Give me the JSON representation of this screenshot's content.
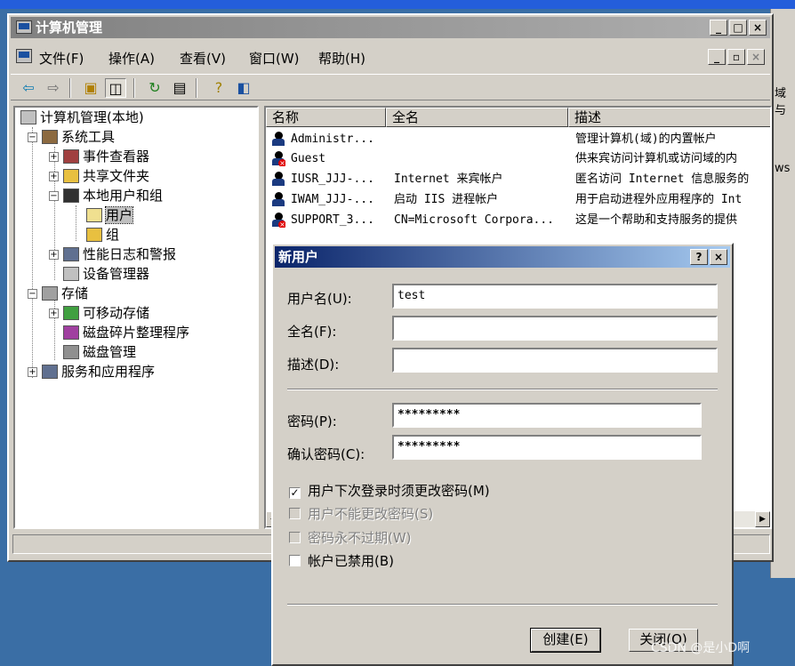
{
  "window": {
    "title": "计算机管理",
    "caption_buttons": [
      "_",
      "□",
      "×"
    ],
    "mdi_buttons": [
      "_",
      "▫",
      "×"
    ]
  },
  "menu": [
    "文件(F)",
    "操作(A)",
    "查看(V)",
    "窗口(W)",
    "帮助(H)"
  ],
  "toolbar": [
    "back-icon",
    "forward-icon",
    "up-folder-icon",
    "show-tree-icon",
    "refresh-icon",
    "export-icon",
    "help-icon",
    "view-icon"
  ],
  "tree": {
    "root": "计算机管理(本地)",
    "system_tools": "系统工具",
    "event_viewer": "事件查看器",
    "shared_folders": "共享文件夹",
    "local_users_groups": "本地用户和组",
    "users": "用户",
    "groups": "组",
    "perf_logs": "性能日志和警报",
    "device_manager": "设备管理器",
    "storage": "存储",
    "removable": "可移动存储",
    "defrag": "磁盘碎片整理程序",
    "disk_mgmt": "磁盘管理",
    "services_apps": "服务和应用程序"
  },
  "list": {
    "columns": [
      "名称",
      "全名",
      "描述"
    ],
    "rows": [
      {
        "name": "Administr...",
        "fullname": "",
        "desc": "管理计算机(域)的内置帐户",
        "disabled": false
      },
      {
        "name": "Guest",
        "fullname": "",
        "desc": "供来宾访问计算机或访问域的内",
        "disabled": true
      },
      {
        "name": "IUSR_JJJ-...",
        "fullname": "Internet 来宾帐户",
        "desc": "匿名访问 Internet 信息服务的",
        "disabled": false
      },
      {
        "name": "IWAM_JJJ-...",
        "fullname": "启动 IIS 进程帐户",
        "desc": "用于启动进程外应用程序的 Int",
        "disabled": false
      },
      {
        "name": "SUPPORT_3...",
        "fullname": "CN=Microsoft Corpora...",
        "desc": "这是一个帮助和支持服务的提供",
        "disabled": true
      }
    ]
  },
  "dialog": {
    "title": "新用户",
    "help_btn": "?",
    "close_btn": "×",
    "username_label": "用户名(U):",
    "username_value": "test",
    "fullname_label": "全名(F):",
    "fullname_value": "",
    "desc_label": "描述(D):",
    "desc_value": "",
    "password_label": "密码(P):",
    "password_value": "*********",
    "confirm_label": "确认密码(C):",
    "confirm_value": "*********",
    "chk_must_change": "用户下次登录时须更改密码(M)",
    "chk_cannot_change": "用户不能更改密码(S)",
    "chk_never_expires": "密码永不过期(W)",
    "chk_disabled": "帐户已禁用(B)",
    "create_btn": "创建(E)",
    "close_btn_label": "关闭(O)"
  },
  "side_text": [
    "域与",
    "ws"
  ],
  "watermark": "CSDN @是小D啊",
  "colors": {
    "desktop": "#3a6ea5",
    "face": "#d4d0c8",
    "dialog_title_start": "#0a246a",
    "dialog_title_end": "#a6caf0",
    "inactive_title": "#808080"
  }
}
